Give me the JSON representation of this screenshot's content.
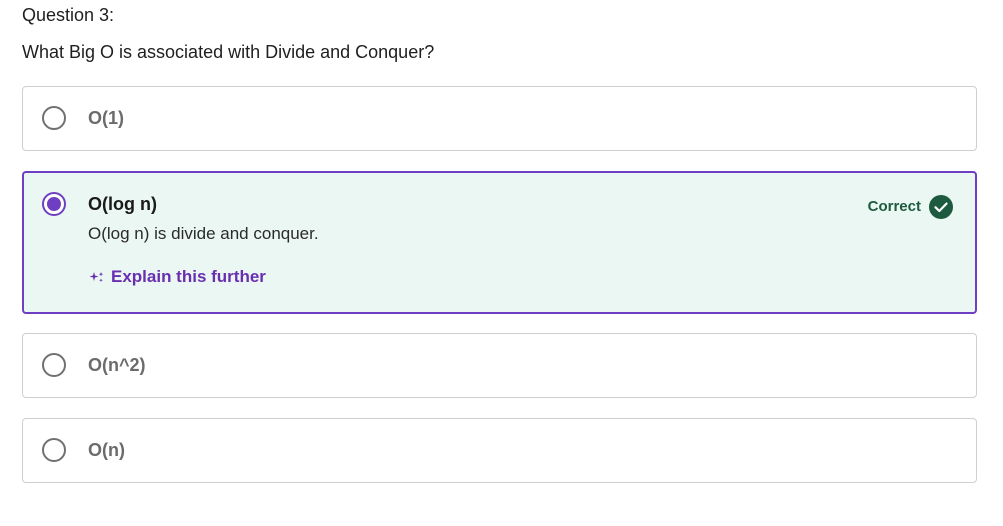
{
  "question": {
    "number_label": "Question 3:",
    "text": "What Big O is associated with Divide and Conquer?"
  },
  "options": [
    {
      "label": "O(1)",
      "selected": false
    },
    {
      "label": "O(log n)",
      "selected": true,
      "status": "Correct",
      "feedback": "O(log n) is divide and conquer.",
      "explain_label": "Explain this further"
    },
    {
      "label": "O(n^2)",
      "selected": false
    },
    {
      "label": "O(n)",
      "selected": false
    }
  ],
  "icons": {
    "explain": "sparkle-icon",
    "correct": "check-circle-icon"
  },
  "colors": {
    "accent": "#6e3fc2",
    "correct_bg": "#eaf7f2",
    "correct_text": "#1d5a40",
    "explain_text": "#6a2fb0",
    "option_border": "#cfcfcf"
  }
}
